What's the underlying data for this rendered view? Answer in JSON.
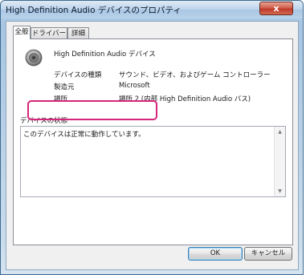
{
  "window": {
    "title": "High Definition Audio デバイスのプロパティ",
    "close_label": "x"
  },
  "tabs": [
    {
      "label": "全般",
      "active": true
    },
    {
      "label": "ドライバー",
      "active": false
    },
    {
      "label": "詳細",
      "active": false
    }
  ],
  "device": {
    "icon": "speaker-icon",
    "name": "High Definition Audio デバイス"
  },
  "properties": [
    {
      "label": "デバイスの種類",
      "value": "サウンド、ビデオ、およびゲーム コントローラー"
    },
    {
      "label": "製造元",
      "value": "Microsoft"
    },
    {
      "label": "場所",
      "value": "場所 2 (内部 High Definition Audio バス)"
    }
  ],
  "status": {
    "group_label": "デバイスの状態",
    "text": "このデバイスは正常に動作しています。"
  },
  "buttons": {
    "ok": "OK",
    "cancel": "キャンセル"
  },
  "colors": {
    "highlight": "#d6257a",
    "close": "#c0392b"
  }
}
